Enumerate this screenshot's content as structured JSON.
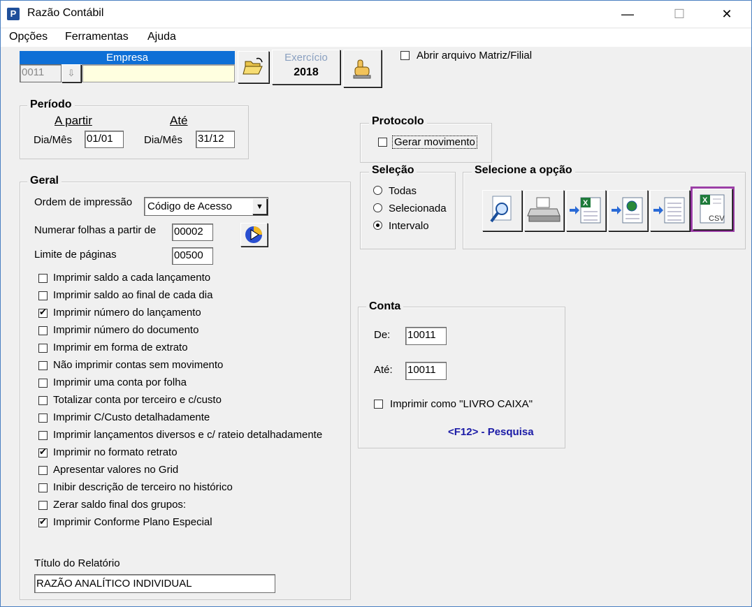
{
  "window": {
    "title": "Razão Contábil",
    "min_glyph": "—",
    "max_glyph": "☐",
    "close_glyph": "✕"
  },
  "menu": [
    {
      "label": "Opções"
    },
    {
      "label": "Ferramentas"
    },
    {
      "label": "Ajuda"
    }
  ],
  "empresa": {
    "header": "Empresa",
    "code": "0011",
    "name": ""
  },
  "exercicio": {
    "label": "Exercício",
    "year": "2018"
  },
  "abrir_matriz": {
    "label": "Abrir arquivo Matriz/Filial",
    "checked": false
  },
  "periodo": {
    "title": "Período",
    "a_partir": "A partir",
    "ate": "Até",
    "dia_mes_label": "Dia/Mês",
    "from_value": "01/01",
    "to_value": "31/12"
  },
  "protocolo": {
    "title": "Protocolo",
    "gerar_label": "Gerar movimento",
    "checked": false
  },
  "selecao": {
    "title": "Seleção",
    "options": [
      "Todas",
      "Selecionada",
      "Intervalo"
    ],
    "selected": "Intervalo"
  },
  "selecione_opcao": {
    "title": "Selecione a opção",
    "buttons": [
      "preview-icon",
      "printer-icon",
      "export-excel-icon",
      "export-web-icon",
      "export-document-icon",
      "export-csv-icon"
    ],
    "csv_label": "CSV",
    "highlight_color": "#9b3fa6"
  },
  "geral": {
    "title": "Geral",
    "ordem_label": "Ordem de impressão",
    "ordem_value": "Código de Acesso",
    "numerar_label": "Numerar folhas a partir de",
    "numerar_value": "00002",
    "limite_label": "Limite de páginas",
    "limite_value": "00500",
    "checkboxes": [
      {
        "label": "Imprimir saldo a cada lançamento",
        "checked": false
      },
      {
        "label": "Imprimir saldo ao final de cada dia",
        "checked": false
      },
      {
        "label": "Imprimir número do lançamento",
        "checked": true
      },
      {
        "label": "Imprimir número do documento",
        "checked": false
      },
      {
        "label": "Imprimir em forma de extrato",
        "checked": false
      },
      {
        "label": "Não imprimir contas sem movimento",
        "checked": false
      },
      {
        "label": "Imprimir uma conta por folha",
        "checked": false
      },
      {
        "label": "Totalizar conta por terceiro e c/custo",
        "checked": false
      },
      {
        "label": "Imprimir C/Custo detalhadamente",
        "checked": false
      },
      {
        "label": "Imprimir lançamentos diversos e c/ rateio detalhadamente",
        "checked": false
      },
      {
        "label": "Imprimir no formato retrato",
        "checked": true
      },
      {
        "label": "Apresentar valores no Grid",
        "checked": false
      },
      {
        "label": "Inibir descrição de terceiro no histórico",
        "checked": false
      },
      {
        "label": "Zerar saldo final dos grupos:",
        "checked": false
      },
      {
        "label": "Imprimir Conforme Plano Especial",
        "checked": true
      }
    ],
    "titulo_label": "Título do Relatório",
    "titulo_value": "RAZÃO ANALÍTICO INDIVIDUAL"
  },
  "conta": {
    "title": "Conta",
    "de_label": "De:",
    "de_value": "10011",
    "ate_label": "Até:",
    "ate_value": "10011",
    "livro_caixa_label": "Imprimir como \"LIVRO CAIXA\"",
    "livro_caixa_checked": false,
    "pesquisa_hint": "<F12> - Pesquisa",
    "hint_color": "#1a1aa6"
  }
}
